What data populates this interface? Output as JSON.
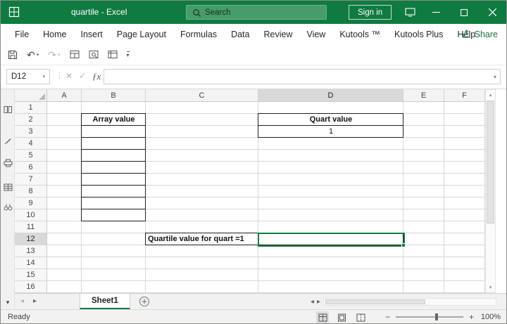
{
  "titlebar": {
    "title": "quartile  -  Excel",
    "search": "Search",
    "sign_in": "Sign in"
  },
  "ribbon": {
    "tabs": [
      "File",
      "Home",
      "Insert",
      "Page Layout",
      "Formulas",
      "Data",
      "Review",
      "View",
      "Kutools ™",
      "Kutools Plus",
      "Help"
    ],
    "share_label": "Share"
  },
  "formula_bar": {
    "name_box": "D12",
    "fx_label": "ƒx",
    "formula_value": ""
  },
  "grid": {
    "column_headers": [
      "A",
      "B",
      "C",
      "D",
      "E",
      "F"
    ],
    "row_count": 16,
    "selected_column": "D",
    "selected_row": 12,
    "active_cell": "D12",
    "cell_texts": [
      {
        "ref": "B2",
        "text": "Array value",
        "bold": true,
        "align": "center"
      },
      {
        "ref": "D2",
        "text": "Quart value",
        "bold": true,
        "align": "center"
      },
      {
        "ref": "D3",
        "text": "1",
        "bold": false,
        "align": "center"
      },
      {
        "ref": "C12",
        "text": "Quartile value for quart =1",
        "bold": true,
        "align": "left"
      }
    ],
    "bordered_ranges": [
      "B2:B10",
      "D2:D3",
      "C12:D12"
    ]
  },
  "sheet_bar": {
    "active_sheet": "Sheet1"
  },
  "status_bar": {
    "status": "Ready",
    "zoom_level": "100%"
  },
  "icons": {
    "dropdown": "▾",
    "undo": "↶",
    "redo": "↷",
    "cancel": "✕",
    "check": "✓",
    "dots": "⋮",
    "tri_left": "◂",
    "tri_right": "▸",
    "tri_up": "▴",
    "tri_down": "▾",
    "minus": "−",
    "plus": "+"
  },
  "colors": {
    "excel_green": "#107C41",
    "titlebar_green": "#0F7B41",
    "search_pill_green": "#479C6C",
    "header_highlight": "#D9D9D9"
  }
}
